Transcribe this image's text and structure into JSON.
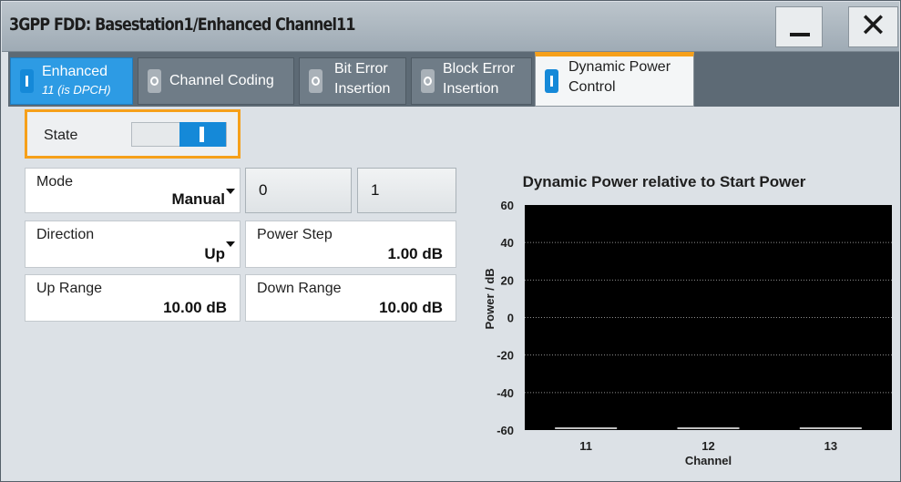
{
  "window": {
    "title": "3GPP FDD: Basestation1/Enhanced Channel11"
  },
  "tabs": [
    {
      "label": "Enhanced",
      "sub": "11 (is DPCH)",
      "state": "on"
    },
    {
      "label": "Channel Coding",
      "state": "off"
    },
    {
      "label": "Bit Error",
      "label2": "Insertion",
      "state": "off"
    },
    {
      "label": "Block Error",
      "label2": "Insertion",
      "state": "off"
    },
    {
      "label": "Dynamic Power",
      "label2": "Control",
      "state": "on",
      "active": true
    }
  ],
  "state": {
    "label": "State",
    "value": "on"
  },
  "mode": {
    "label": "Mode",
    "value": "Manual"
  },
  "buttons": {
    "zero": "0",
    "one": "1"
  },
  "direction": {
    "label": "Direction",
    "value": "Up"
  },
  "power_step": {
    "label": "Power Step",
    "value": "1.00 dB"
  },
  "up_range": {
    "label": "Up Range",
    "value": "10.00 dB"
  },
  "down_range": {
    "label": "Down Range",
    "value": "10.00 dB"
  },
  "colors": {
    "accent": "#f6a01a",
    "toggle_on": "#1589d8",
    "chart_bg": "#000000",
    "chart_line": "#ffffff"
  },
  "chart_data": {
    "type": "line",
    "title": "Dynamic Power relative to Start Power",
    "xlabel": "Channel",
    "ylabel": "Power / dB",
    "categories": [
      "11",
      "12",
      "13"
    ],
    "series": [
      {
        "values": [
          -60,
          -60,
          -60
        ]
      }
    ],
    "ylim": [
      -60,
      60
    ],
    "yticks": [
      "60",
      "40",
      "20",
      "0",
      "-20",
      "-40",
      "-60"
    ],
    "grid": "dotted horizontal"
  }
}
